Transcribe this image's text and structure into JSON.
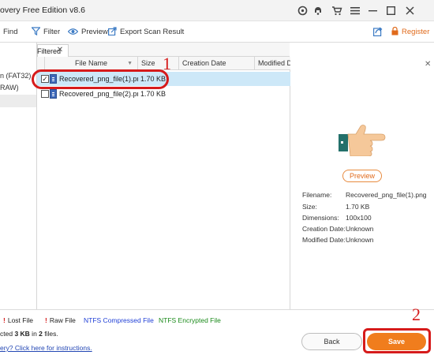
{
  "window": {
    "title": "overy Free Edition v8.6",
    "title_icons": [
      "refresh-circle-icon",
      "support-icon",
      "cart-icon",
      "menu-icon",
      "minimize-icon",
      "maximize-icon",
      "close-icon"
    ]
  },
  "toolbar": {
    "find_label": "Find",
    "filter_label": "Filter",
    "preview_label": "Preview",
    "export_label": "Export Scan Result",
    "register_label": "Register"
  },
  "tree": {
    "items": [
      {
        "label": "n (FAT32)"
      },
      {
        "label": "RAW)"
      }
    ]
  },
  "tab": {
    "label": "Filtered",
    "close_glyph": "✕"
  },
  "table": {
    "columns": [
      "File Name",
      "Size",
      "Creation Date",
      "Modified Da"
    ],
    "rows": [
      {
        "checked": true,
        "name": "Recovered_png_file(1).png",
        "size": "1.70 KB",
        "creation": "",
        "modified": ""
      },
      {
        "checked": false,
        "name": "Recovered_png_file(2).png",
        "size": "1.70 KB",
        "creation": "",
        "modified": ""
      }
    ]
  },
  "preview": {
    "button_label": "Preview",
    "close_glyph": "✕",
    "props": [
      {
        "label": "Filename:",
        "value": "Recovered_png_file(1).png"
      },
      {
        "label": "Size:",
        "value": "1.70 KB"
      },
      {
        "label": "Dimensions:",
        "value": "100x100"
      },
      {
        "label": "Creation Date:",
        "value": "Unknown"
      },
      {
        "label": "Modified Date:",
        "value": "Unknown"
      }
    ]
  },
  "legend": {
    "lost_file": "Lost File",
    "raw_file": "Raw File",
    "ntfs_compressed": "NTFS Compressed File",
    "ntfs_encrypted": "NTFS Encrypted File",
    "colors": {
      "compressed": "#1f3fd6",
      "encrypted": "#1a8a1a",
      "mark": "#d61b1b"
    }
  },
  "status": {
    "prefix": "cted ",
    "size": "3 KB",
    "middle": " in ",
    "count": "2",
    "suffix": " files.",
    "help_link": "ery? Click here for instructions."
  },
  "buttons": {
    "back_label": "Back",
    "save_label": "Save"
  },
  "annotations": {
    "step1": "1",
    "step2": "2",
    "color": "#d61b1b"
  },
  "colors": {
    "accent": "#f07d1d",
    "selection": "#cde8f8",
    "link": "#2347b4"
  }
}
